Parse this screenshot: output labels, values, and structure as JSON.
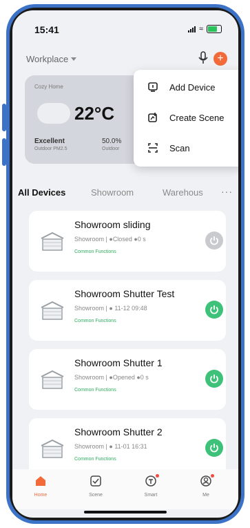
{
  "status_bar": {
    "time": "15:41"
  },
  "header": {
    "workplace_label": "Workplace"
  },
  "weather": {
    "home_name": "Cozy Home",
    "temperature": "22°C",
    "air_quality": "Excellent",
    "air_quality_sub": "Outdoor PM2.5",
    "humidity": "50.0%",
    "humidity_sub": "Outdoor"
  },
  "menu": {
    "items": [
      {
        "label": "Add Device",
        "icon": "add-device-icon"
      },
      {
        "label": "Create Scene",
        "icon": "create-scene-icon"
      },
      {
        "label": "Scan",
        "icon": "scan-icon"
      }
    ]
  },
  "tabs": {
    "items": [
      "All Devices",
      "Showroom",
      "Warehous"
    ],
    "more": "···"
  },
  "devices": [
    {
      "name": "Showroom sliding",
      "room": "Showroom",
      "status": "Closed",
      "extra": "0 s",
      "link": "Common Functions",
      "power_color": "#c8cacd"
    },
    {
      "name": "Showroom Shutter Test",
      "room": "Showroom",
      "status": "",
      "extra": "11-12 09:48",
      "link": "Common Functions",
      "power_color": "#3ec27a"
    },
    {
      "name": "Showroom Shutter 1",
      "room": "Showroom",
      "status": "Opened",
      "extra": "0 s",
      "link": "Common Functions",
      "power_color": "#3ec27a"
    },
    {
      "name": "Showroom Shutter 2",
      "room": "Showroom",
      "status": "",
      "extra": "11-01 16:31",
      "link": "Common Functions",
      "power_color": "#3ec27a"
    }
  ],
  "tabbar": {
    "items": [
      "Home",
      "Scene",
      "Smart",
      "Me"
    ]
  },
  "colors": {
    "accent": "#f26a3a",
    "frame": "#3c73c6",
    "on": "#3ec27a",
    "off": "#c8cacd"
  }
}
